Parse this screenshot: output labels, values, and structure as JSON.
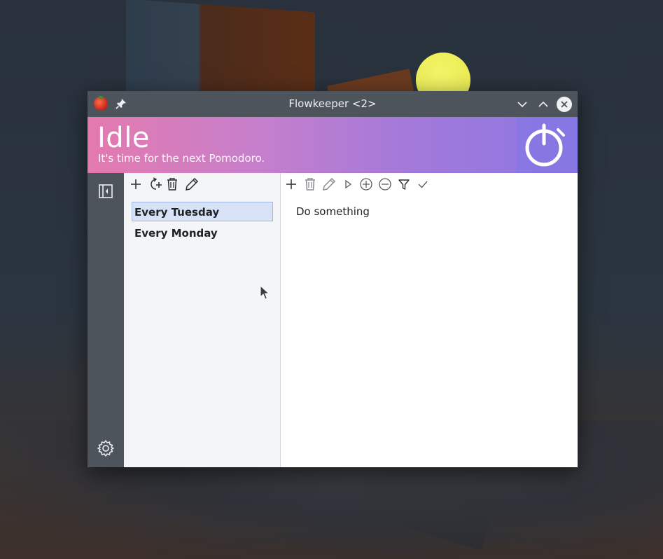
{
  "window": {
    "title": "Flowkeeper <2>"
  },
  "header": {
    "state": "Idle",
    "subtitle": "It's time for the next Pomodoro."
  },
  "backlogs": {
    "toolbar": [
      "add-icon",
      "refresh-add-icon",
      "delete-icon",
      "edit-icon"
    ],
    "items": [
      {
        "label": "Every Tuesday",
        "selected": true
      },
      {
        "label": "Every Monday",
        "selected": false
      }
    ]
  },
  "workitems": {
    "toolbar": [
      "add-icon",
      "delete-icon",
      "edit-icon",
      "start-icon",
      "add-pomodoro-icon",
      "remove-pomodoro-icon",
      "filter-icon",
      "complete-icon"
    ],
    "items": [
      {
        "label": "Do something"
      }
    ]
  },
  "colors": {
    "titlebar": "#4d545c",
    "header_start": "#e47aae",
    "header_end": "#8b78e2",
    "selection": "#d8e2f6"
  }
}
